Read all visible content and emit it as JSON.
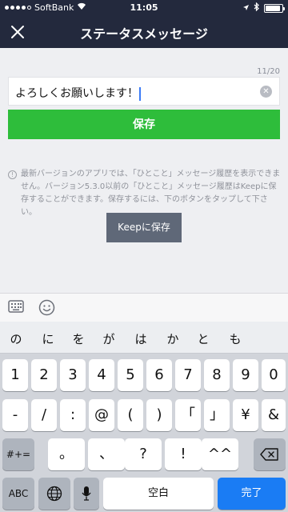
{
  "status": {
    "carrier": "SoftBank",
    "time": "11:05",
    "signal": 4,
    "battery_level": 0.9
  },
  "nav": {
    "title": "ステータスメッセージ"
  },
  "message": {
    "counter": "11/20",
    "value": "よろしくお願いします！"
  },
  "buttons": {
    "save": "保存",
    "keep": "Keepに保存"
  },
  "notice": {
    "text": "最新バージョンのアプリでは、「ひとこと」メッセージ履歴を表示できません。バージョン5.3.0以前の「ひとこと」メッセージ履歴はKeepに保存することができます。保存するには、下のボタンをタップして下さい。"
  },
  "toolbar": {
    "icons": [
      "keyboard-icon",
      "smile-icon"
    ]
  },
  "keyboard": {
    "predictions": [
      "の",
      "に",
      "を",
      "が",
      "は",
      "か",
      "と",
      "も"
    ],
    "row1": [
      "1",
      "2",
      "3",
      "4",
      "5",
      "6",
      "7",
      "8",
      "9",
      "0"
    ],
    "row2": [
      "-",
      "/",
      ":",
      "@",
      "(",
      ")",
      "「",
      "」",
      "¥",
      "&"
    ],
    "row3": {
      "mode": "#+=",
      "keys": [
        "。",
        "、",
        "?",
        "!",
        "^^"
      ]
    },
    "row4": {
      "abc": "ABC",
      "space": "空白",
      "done": "完了"
    }
  },
  "colors": {
    "header": "#23293d",
    "save_green": "#2ebd3b",
    "keep_gray": "#5f6878",
    "done_blue": "#1a7cf4"
  }
}
